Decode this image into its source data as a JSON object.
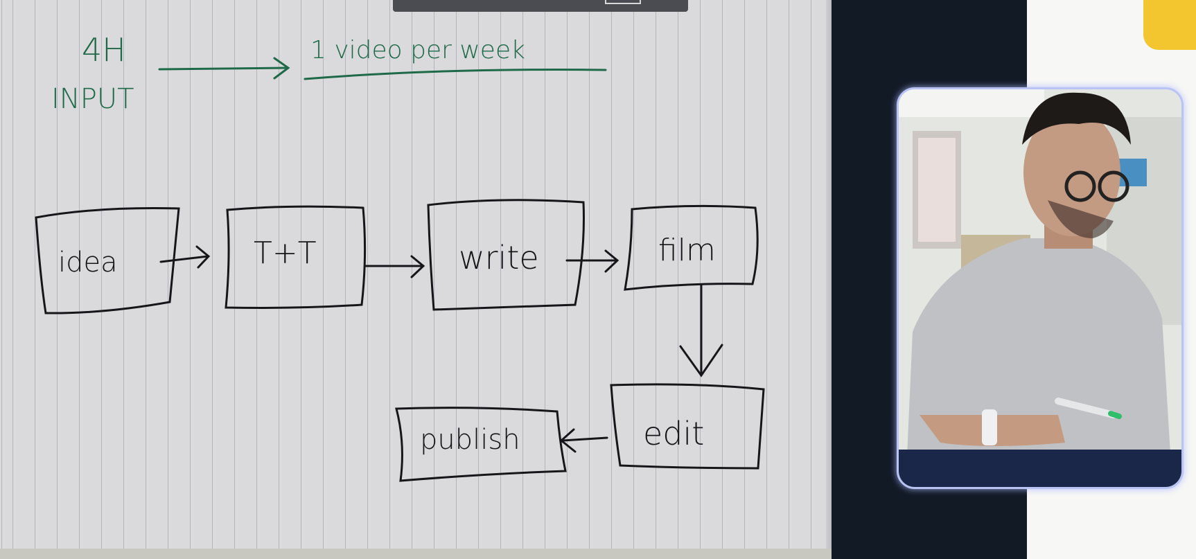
{
  "whiteboard": {
    "input_amount": "4H",
    "input_label": "INPUT",
    "output_label": "1 video per week",
    "steps": {
      "idea": "idea",
      "tt": "T+T",
      "write": "write",
      "film": "film",
      "edit": "edit",
      "publish": "publish"
    }
  },
  "colors": {
    "green_marker": "#1e6a48",
    "black_marker": "#16161a",
    "accent_yellow": "#f3c52e",
    "webcam_glow": "#b9c4f5"
  }
}
